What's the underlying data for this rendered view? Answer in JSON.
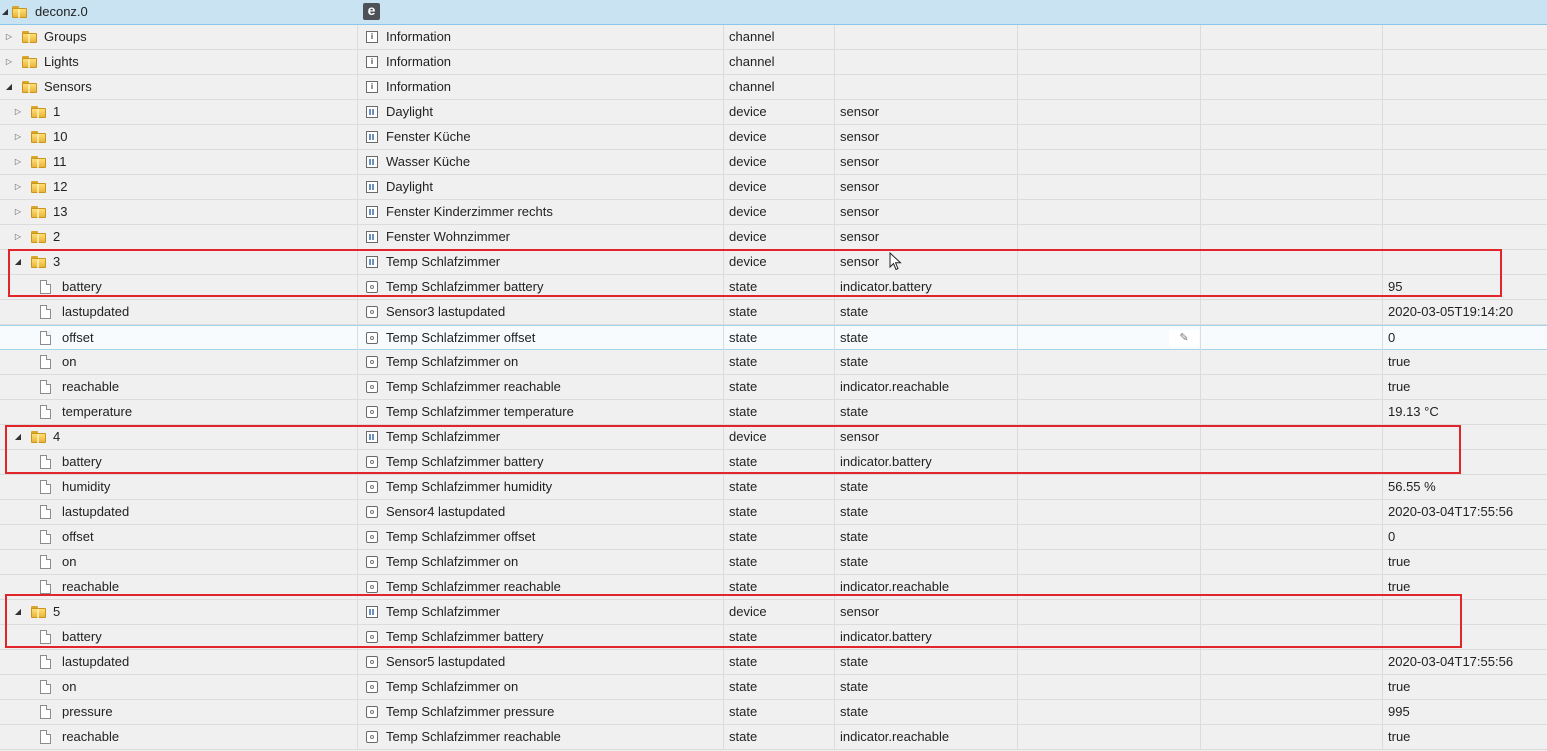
{
  "root": {
    "name": "deconz.0",
    "icon": "e"
  },
  "rows": [
    {
      "name": "Groups",
      "desc": "Information",
      "type": "channel",
      "role": "",
      "value": ""
    },
    {
      "name": "Lights",
      "desc": "Information",
      "type": "channel",
      "role": "",
      "value": ""
    },
    {
      "name": "Sensors",
      "desc": "Information",
      "type": "channel",
      "role": "",
      "value": ""
    },
    {
      "name": "1",
      "desc": "Daylight",
      "type": "device",
      "role": "sensor",
      "value": ""
    },
    {
      "name": "10",
      "desc": "Fenster Küche",
      "type": "device",
      "role": "sensor",
      "value": ""
    },
    {
      "name": "11",
      "desc": "Wasser Küche",
      "type": "device",
      "role": "sensor",
      "value": ""
    },
    {
      "name": "12",
      "desc": "Daylight",
      "type": "device",
      "role": "sensor",
      "value": ""
    },
    {
      "name": "13",
      "desc": "Fenster Kinderzimmer rechts",
      "type": "device",
      "role": "sensor",
      "value": ""
    },
    {
      "name": "2",
      "desc": "Fenster Wohnzimmer",
      "type": "device",
      "role": "sensor",
      "value": ""
    },
    {
      "name": "3",
      "desc": "Temp Schlafzimmer",
      "type": "device",
      "role": "sensor",
      "value": ""
    },
    {
      "name": "battery",
      "desc": "Temp Schlafzimmer battery",
      "type": "state",
      "role": "indicator.battery",
      "value": "95"
    },
    {
      "name": "lastupdated",
      "desc": "Sensor3 lastupdated",
      "type": "state",
      "role": "state",
      "value": "2020-03-05T19:14:20"
    },
    {
      "name": "offset",
      "desc": "Temp Schlafzimmer offset",
      "type": "state",
      "role": "state",
      "value": "0"
    },
    {
      "name": "on",
      "desc": "Temp Schlafzimmer on",
      "type": "state",
      "role": "state",
      "value": "true"
    },
    {
      "name": "reachable",
      "desc": "Temp Schlafzimmer reachable",
      "type": "state",
      "role": "indicator.reachable",
      "value": "true"
    },
    {
      "name": "temperature",
      "desc": "Temp Schlafzimmer temperature",
      "type": "state",
      "role": "state",
      "value": "19.13 °C"
    },
    {
      "name": "4",
      "desc": "Temp Schlafzimmer",
      "type": "device",
      "role": "sensor",
      "value": ""
    },
    {
      "name": "battery",
      "desc": "Temp Schlafzimmer battery",
      "type": "state",
      "role": "indicator.battery",
      "value": ""
    },
    {
      "name": "humidity",
      "desc": "Temp Schlafzimmer humidity",
      "type": "state",
      "role": "state",
      "value": "56.55 %"
    },
    {
      "name": "lastupdated",
      "desc": "Sensor4 lastupdated",
      "type": "state",
      "role": "state",
      "value": "2020-03-04T17:55:56"
    },
    {
      "name": "offset",
      "desc": "Temp Schlafzimmer offset",
      "type": "state",
      "role": "state",
      "value": "0"
    },
    {
      "name": "on",
      "desc": "Temp Schlafzimmer on",
      "type": "state",
      "role": "state",
      "value": "true"
    },
    {
      "name": "reachable",
      "desc": "Temp Schlafzimmer reachable",
      "type": "state",
      "role": "indicator.reachable",
      "value": "true"
    },
    {
      "name": "5",
      "desc": "Temp Schlafzimmer",
      "type": "device",
      "role": "sensor",
      "value": ""
    },
    {
      "name": "battery",
      "desc": "Temp Schlafzimmer battery",
      "type": "state",
      "role": "indicator.battery",
      "value": ""
    },
    {
      "name": "lastupdated",
      "desc": "Sensor5 lastupdated",
      "type": "state",
      "role": "state",
      "value": "2020-03-04T17:55:56"
    },
    {
      "name": "on",
      "desc": "Temp Schlafzimmer on",
      "type": "state",
      "role": "state",
      "value": "true"
    },
    {
      "name": "pressure",
      "desc": "Temp Schlafzimmer pressure",
      "type": "state",
      "role": "state",
      "value": "995"
    },
    {
      "name": "reachable",
      "desc": "Temp Schlafzimmer reachable",
      "type": "state",
      "role": "indicator.reachable",
      "value": "true"
    }
  ],
  "edit_button": {
    "icon": "pencil-icon",
    "glyph": "✎"
  },
  "colors": {
    "header_bg": "#c9e3f2",
    "highlight": "#e0262b",
    "folder": "#f2c94c"
  }
}
